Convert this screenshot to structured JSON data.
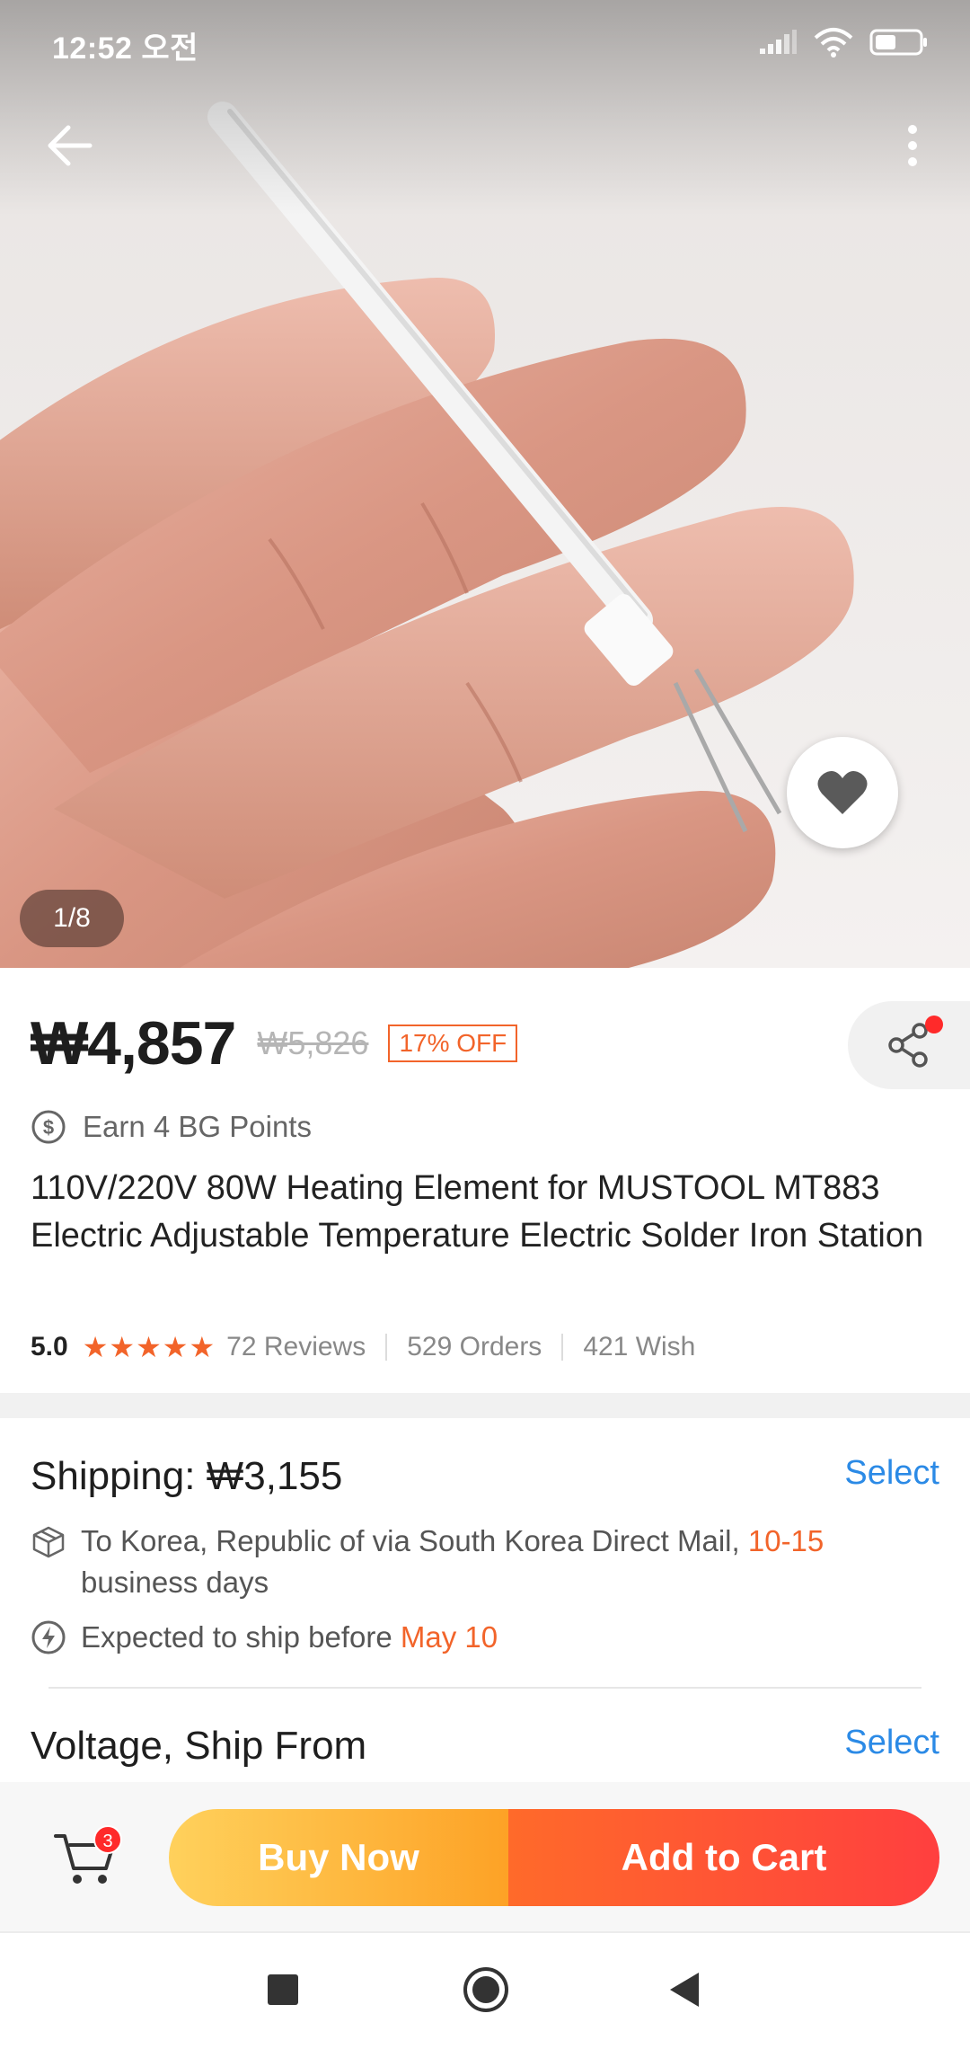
{
  "status_bar": {
    "time": "12:52 오전"
  },
  "product_image": {
    "counter": "1/8"
  },
  "price": {
    "current": "₩4,857",
    "original": "₩5,826",
    "discount": "17% OFF"
  },
  "points": {
    "text": "Earn 4 BG Points"
  },
  "product": {
    "title": "110V/220V 80W Heating Element for MUSTOOL MT883 Electric Adjustable Temperature Electric Solder Iron Station"
  },
  "stats": {
    "rating": "5.0",
    "stars": "★★★★★",
    "reviews": "72 Reviews",
    "orders": "529 Orders",
    "wish": "421 Wish"
  },
  "shipping": {
    "label": "Shipping:",
    "cost": "₩3,155",
    "select": "Select",
    "route": "To Korea, Republic of via South Korea Direct Mail,",
    "days_range": "10-15",
    "days_unit": "business days",
    "expected_prefix": "Expected to ship before",
    "expected_date": "May 10"
  },
  "options": {
    "label": "Voltage, Ship From",
    "select": "Select"
  },
  "action_bar": {
    "cart_count": "3",
    "buy_now": "Buy Now",
    "add_to_cart": "Add to Cart"
  },
  "colors": {
    "accent_orange": "#f2642a",
    "link_blue": "#2b8ae6",
    "badge_red": "#ff2a2a"
  },
  "icons": {
    "back": "arrow-left-icon",
    "more": "more-vertical-icon",
    "wish": "heart-icon",
    "share": "share-icon",
    "points": "dollar-circle-icon",
    "route": "package-icon",
    "expected": "lightning-icon",
    "cart": "cart-icon"
  }
}
